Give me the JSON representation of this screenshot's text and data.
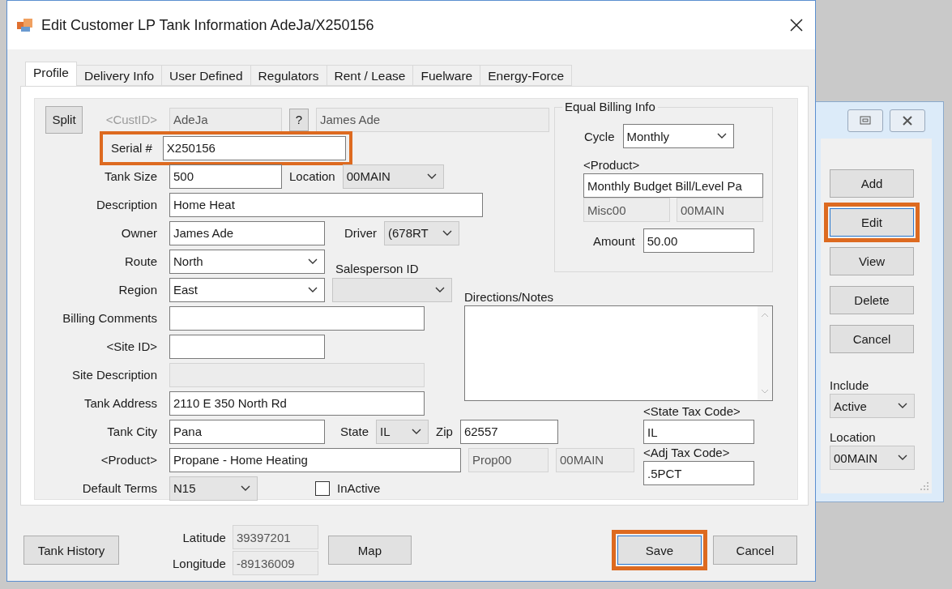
{
  "window": {
    "title": "Edit Customer LP Tank Information AdeJa/X250156"
  },
  "tabs": [
    {
      "label": "Profile",
      "selected": true
    },
    {
      "label": "Delivery Info",
      "selected": false
    },
    {
      "label": "User Defined",
      "selected": false
    },
    {
      "label": "Regulators",
      "selected": false
    },
    {
      "label": "Rent / Lease",
      "selected": false
    },
    {
      "label": "Fuelware",
      "selected": false
    },
    {
      "label": "Energy-Force",
      "selected": false
    }
  ],
  "customer": {
    "split_button": "Split",
    "custid_label": "<CustID>",
    "custid": {
      "value": "AdeJa",
      "disabled": true
    },
    "lookup_button": "?",
    "customer_name": {
      "value": "James Ade",
      "disabled": true
    }
  },
  "serial": {
    "label": "Serial #",
    "value": "X250156",
    "highlighted": true
  },
  "tank_size": {
    "label": "Tank Size",
    "value": "500"
  },
  "location": {
    "label": "Location",
    "value": "00MAIN",
    "disabled": true
  },
  "description": {
    "label": "Description",
    "value": "Home Heat"
  },
  "owner": {
    "label": "Owner",
    "value": "James Ade"
  },
  "driver": {
    "label": "Driver",
    "value": "(678RT",
    "disabled": true
  },
  "route": {
    "label": "Route",
    "value": "North",
    "disabled": false
  },
  "salesperson": {
    "label": "Salesperson ID",
    "disabled": true
  },
  "region": {
    "label": "Region",
    "value": "East",
    "disabled": false
  },
  "billing_comments": {
    "label": "Billing Comments"
  },
  "site_id": {
    "label": "<Site ID>"
  },
  "site_description": {
    "label": "Site Description",
    "disabled": true
  },
  "tank_address": {
    "label": "Tank Address",
    "value": "2110 E 350 North Rd"
  },
  "tank_city": {
    "label": "Tank City",
    "value": "Pana"
  },
  "state": {
    "label": "State",
    "value": "IL",
    "disabled": true
  },
  "zip": {
    "label": "Zip",
    "value": "62557"
  },
  "product": {
    "label": "<Product>",
    "value": "Propane - Home Heating",
    "code": "Prop00",
    "location": "00MAIN"
  },
  "default_terms": {
    "label": "Default Terms",
    "value": "N15",
    "disabled": true
  },
  "inactive": {
    "label": "InActive",
    "checked": false
  },
  "equal_billing": {
    "title": "Equal Billing Info",
    "cycle_label": "Cycle",
    "cycle": "Monthly",
    "product_label": "<Product>",
    "product": "Monthly Budget Bill/Level Pa",
    "product_code": "Misc00",
    "product_location": "00MAIN",
    "amount_label": "Amount",
    "amount": "50.00"
  },
  "directions": {
    "label": "Directions/Notes"
  },
  "state_tax": {
    "label": "<State Tax Code>",
    "value": "IL"
  },
  "adj_tax": {
    "label": "<Adj Tax Code>",
    "value": ".5PCT"
  },
  "footer": {
    "tank_history": "Tank History",
    "latitude_label": "Latitude",
    "latitude": "39397201",
    "longitude_label": "Longitude",
    "longitude": "-89136009",
    "map": "Map",
    "save": {
      "label": "Save",
      "highlighted": true
    },
    "cancel": "Cancel"
  },
  "side_window": {
    "buttons": [
      {
        "label": "Add",
        "highlighted": false
      },
      {
        "label": "Edit",
        "highlighted": true
      },
      {
        "label": "View",
        "highlighted": false
      },
      {
        "label": "Delete",
        "highlighted": false
      },
      {
        "label": "Cancel",
        "highlighted": false
      }
    ],
    "include_label": "Include",
    "include": "Active",
    "location_label": "Location",
    "location": "00MAIN"
  }
}
